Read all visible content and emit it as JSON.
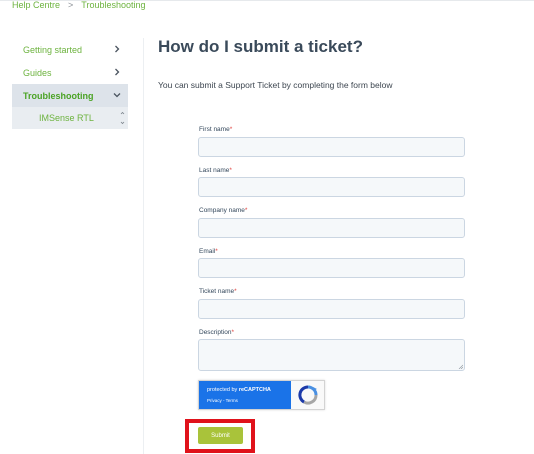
{
  "breadcrumb": {
    "home": "Help Centre",
    "separator": ">",
    "current": "Troubleshooting"
  },
  "sidebar": {
    "items": [
      {
        "label": "Getting started"
      },
      {
        "label": "Guides"
      },
      {
        "label": "Troubleshooting"
      }
    ],
    "subitem": {
      "label": "IMSense RTL"
    }
  },
  "page": {
    "title": "How do I submit a ticket?",
    "intro": "You can submit a Support Ticket by completing the form below"
  },
  "form": {
    "required_mark": "*",
    "fields": [
      {
        "label": "First name",
        "value": ""
      },
      {
        "label": "Last name",
        "value": ""
      },
      {
        "label": "Company name",
        "value": ""
      },
      {
        "label": "Email",
        "value": ""
      },
      {
        "label": "Ticket name",
        "value": ""
      },
      {
        "label": "Description",
        "value": ""
      }
    ],
    "submit_label": "Submit"
  },
  "recaptcha": {
    "protected_by": "protected by",
    "brand": "reCAPTCHA",
    "links": "Privacy - Terms"
  },
  "colors": {
    "accent_green": "#6db33f",
    "submit_green": "#a9c33a",
    "highlight_red": "#e0121b",
    "recaptcha_blue": "#1a73e8"
  }
}
